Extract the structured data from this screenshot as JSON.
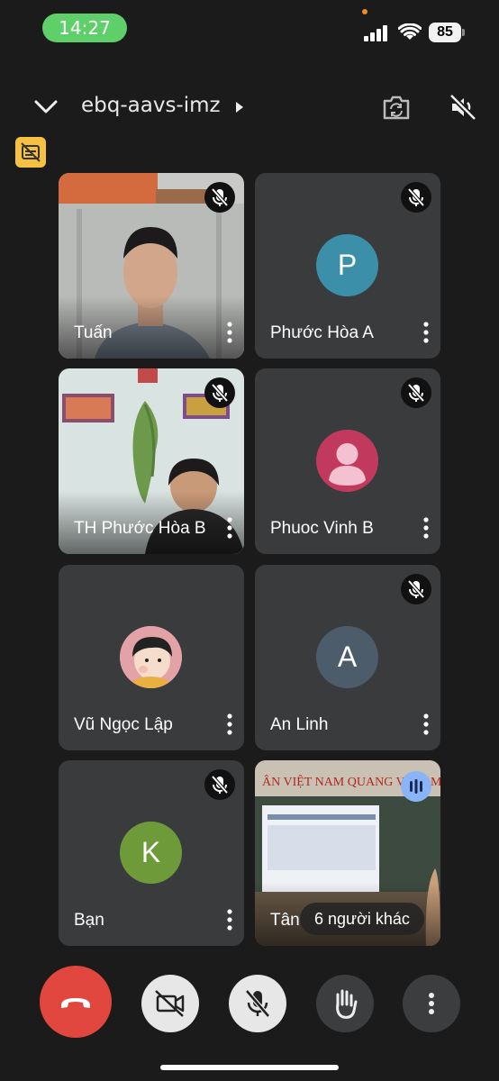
{
  "status_bar": {
    "time": "14:27",
    "battery": "85"
  },
  "header": {
    "meeting_code": "ebq-aavs-imz"
  },
  "tiles": [
    {
      "name": "Tuấn",
      "type": "video",
      "muted": true
    },
    {
      "name": "Phước Hòa A",
      "type": "avatar",
      "initial": "P",
      "avatar_color": "#3b8fa8",
      "muted": true
    },
    {
      "name": "TH Phước Hòa B",
      "type": "video",
      "muted": true
    },
    {
      "name": "Phuoc Vinh B",
      "type": "avatar-icon",
      "avatar_color": "#c13a5e",
      "muted": true
    },
    {
      "name": "Vũ Ngọc Lập",
      "type": "avatar-image",
      "muted": false
    },
    {
      "name": "An Linh",
      "type": "avatar",
      "initial": "A",
      "avatar_color": "#4d5c6b",
      "muted": true
    },
    {
      "name": "Bạn",
      "type": "avatar",
      "initial": "K",
      "avatar_color": "#6f9a3a",
      "muted": true
    },
    {
      "name": "Tân",
      "type": "video",
      "speaking": true,
      "others_label": "6 người khác",
      "banner_text": "ÂN VIỆT NAM QUANG VINH MUÔN NĂM"
    }
  ],
  "controls": [
    "end-call",
    "camera-off",
    "microphone-off",
    "raise-hand",
    "more-options"
  ]
}
